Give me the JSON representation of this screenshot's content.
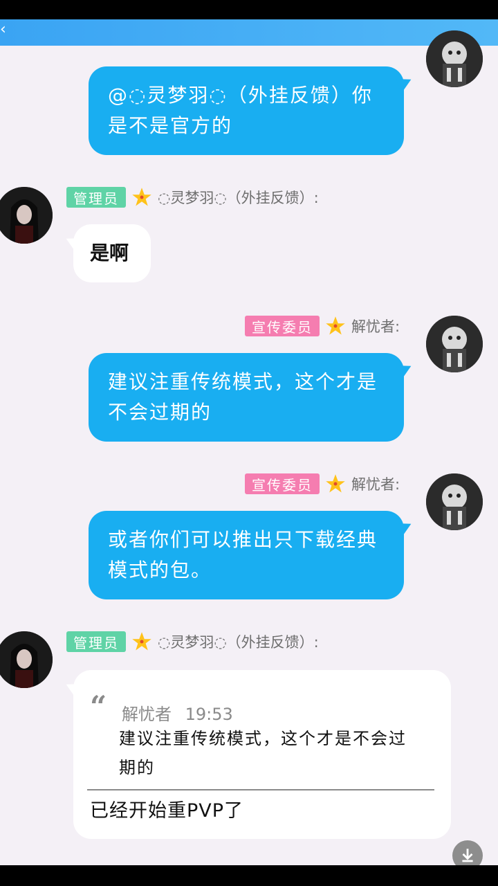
{
  "colors": {
    "accent": "#19aef1",
    "admin_badge": "#5fd3a6",
    "promo_badge": "#f57db0",
    "background": "#f4f0f6"
  },
  "messages": [
    {
      "id": "m1",
      "side": "right",
      "text": "@◌灵梦羽◌（外挂反馈）你是不是官方的"
    },
    {
      "id": "m2",
      "side": "left",
      "badge": "管理员",
      "sender": "◌灵梦羽◌（外挂反馈）:",
      "text": "是啊"
    },
    {
      "id": "m3",
      "side": "right",
      "badge": "宣传委员",
      "sender": "解忧者:",
      "text": "建议注重传统模式，这个才是不会过期的"
    },
    {
      "id": "m4",
      "side": "right",
      "badge": "宣传委员",
      "sender": "解忧者:",
      "text": "或者你们可以推出只下载经典模式的包。"
    },
    {
      "id": "m5",
      "side": "left",
      "badge": "管理员",
      "sender": "◌灵梦羽◌（外挂反馈）:",
      "quote": {
        "author": "解忧者",
        "time": "19:53",
        "text": "建议注重传统模式，这个才是不会过期的"
      },
      "text": "已经开始重PVP了"
    }
  ],
  "icons": {
    "back": "back-arrow-icon",
    "download": "download-icon",
    "star": "star-icon"
  }
}
